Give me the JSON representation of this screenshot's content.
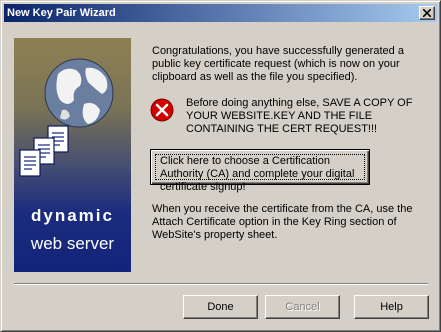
{
  "window": {
    "title": "New Key Pair Wizard"
  },
  "banner": {
    "brand_line1": "dynamic",
    "brand_line2": "web server"
  },
  "content": {
    "congrats": "Congratulations, you have successfully generated a public key certificate request (which is now on your clipboard as well as the file you specified).",
    "warning": "Before doing anything else, SAVE A COPY OF YOUR WEBSITE.KEY AND THE FILE CONTAINING THE CERT REQUEST!!!",
    "ca_button": "Click here to choose a Certification Authority (CA) and complete your digital certificate signup!",
    "attach": "When you receive the certificate from the CA, use the Attach Certificate option in the Key Ring section of WebSite's property sheet."
  },
  "buttons": {
    "done": "Done",
    "cancel": "Cancel",
    "help": "Help"
  },
  "icons": {
    "close": "close-icon",
    "error": "error-icon",
    "globe": "globe-icon",
    "documents": "documents-icon"
  },
  "colors": {
    "titlebar_start": "#0a246a",
    "titlebar_end": "#a6caf0",
    "dialog_face": "#d4d0c8",
    "banner_top": "#8d8052",
    "banner_bottom": "#132478",
    "error_red": "#d40000"
  }
}
